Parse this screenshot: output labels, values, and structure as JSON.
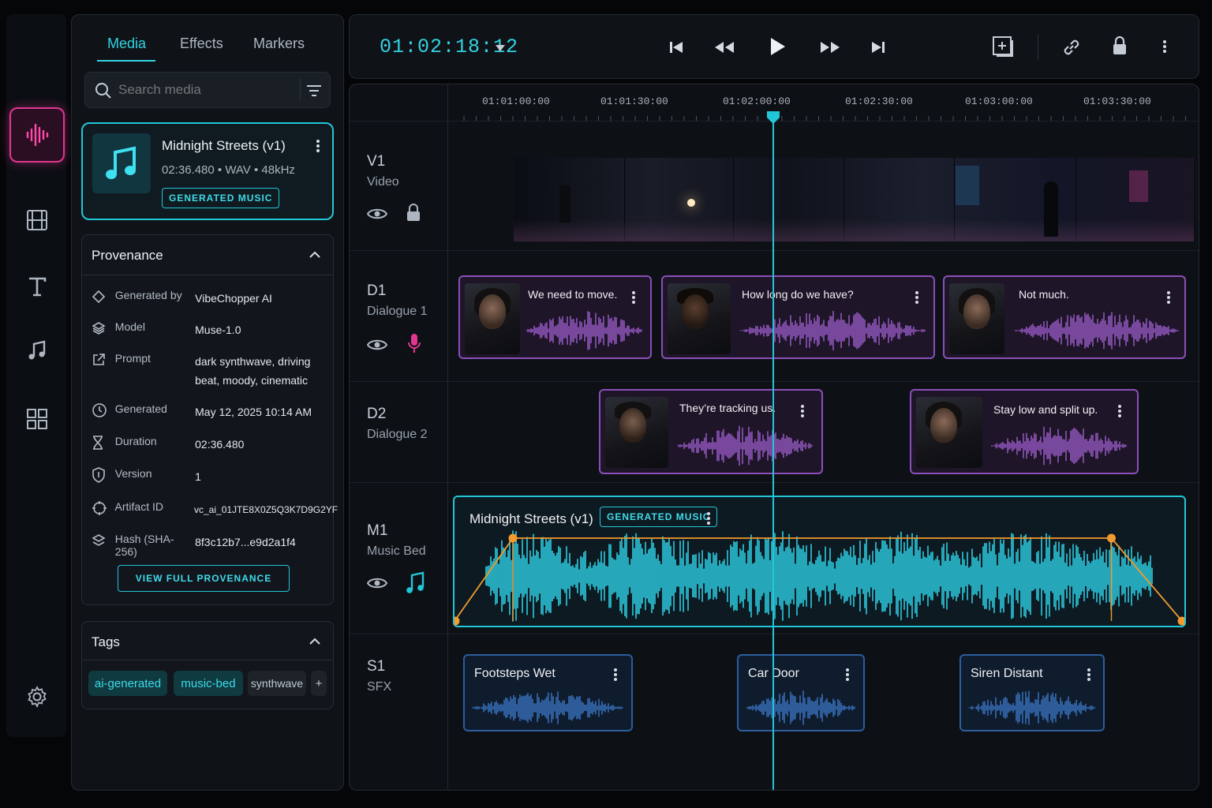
{
  "colors": {
    "accent": "#33d3e3",
    "music": "#22c6d8",
    "dialogue": "#8a4fb8",
    "sfx": "#2c5d9e",
    "rail_active": "#e0368f",
    "envelope": "#f29a2e"
  },
  "rail": {
    "items": [
      {
        "icon": "waveform-icon",
        "active": true
      },
      {
        "icon": "film-icon"
      },
      {
        "icon": "text-icon"
      },
      {
        "icon": "music-note-icon"
      },
      {
        "icon": "grid-icon"
      }
    ],
    "settings_icon": "gear-icon"
  },
  "left": {
    "tabs": [
      "Media",
      "Effects",
      "Markers"
    ],
    "search_placeholder": "Search media",
    "asset": {
      "title": "Midnight Streets (v1)",
      "meta": "02:36.480  •  WAV  •  48kHz",
      "badge": "GENERATED MUSIC"
    },
    "provenance": {
      "title": "Provenance",
      "rows": [
        {
          "icon": "tag-icon",
          "k": "Generated by",
          "v": "VibeChopper AI"
        },
        {
          "icon": "layers-icon",
          "k": "Model",
          "v": "Muse-1.0"
        },
        {
          "icon": "external-link-icon",
          "k": "Prompt",
          "v": "dark synthwave, driving beat, moody, cinematic"
        },
        {
          "icon": "clock-icon",
          "k": "Generated",
          "v": "May 12, 2025  10:14 AM"
        },
        {
          "icon": "hourglass-icon",
          "k": "Duration",
          "v": "02:36.480"
        },
        {
          "icon": "shield-icon",
          "k": "Version",
          "v": "1"
        },
        {
          "icon": "crosshair-icon",
          "k": "Artifact ID",
          "v": "vc_ai_01JTE8X0Z5Q3K7D9G2YF"
        },
        {
          "icon": "hash-layers-icon",
          "k": "Hash (SHA-256)",
          "v": "8f3c12b7...e9d2a1f4"
        }
      ],
      "button": "VIEW FULL PROVENANCE"
    },
    "tags": {
      "title": "Tags",
      "items": [
        "ai-generated",
        "music-bed",
        "synthwave"
      ],
      "add": "+"
    }
  },
  "top": {
    "timecode": "01:02:18:12"
  },
  "timeline": {
    "ticks": [
      "01:01:00:00",
      "01:01:30:00",
      "01:02:00:00",
      "01:02:30:00",
      "01:03:00:00",
      "01:03:30:00"
    ],
    "tracks": [
      {
        "id": "V1",
        "name": "Video"
      },
      {
        "id": "D1",
        "name": "Dialogue 1"
      },
      {
        "id": "D2",
        "name": "Dialogue 2"
      },
      {
        "id": "M1",
        "name": "Music Bed"
      },
      {
        "id": "S1",
        "name": "SFX"
      }
    ],
    "d1_clips": [
      "We need to move.",
      "How long do we have?",
      "Not much."
    ],
    "d2_clips": [
      "They’re tracking us.",
      "Stay low and split up."
    ],
    "music_clip": {
      "title": "Midnight Streets (v1)",
      "badge": "GENERATED MUSIC",
      "fade_in": 0.08,
      "fade_out": 0.1
    },
    "sfx_clips": [
      "Footsteps Wet",
      "Car Door",
      "Siren Distant"
    ]
  }
}
